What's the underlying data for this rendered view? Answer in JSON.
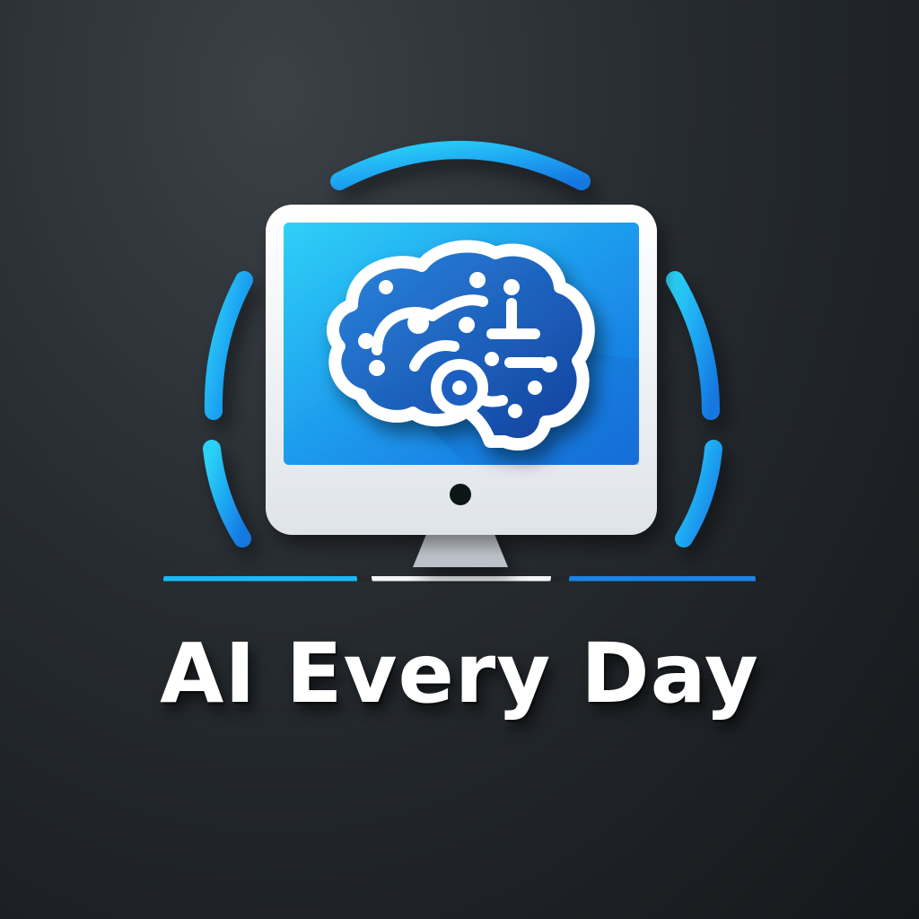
{
  "brand": {
    "name": "AI Every Day"
  },
  "icons": {
    "logo": "monitor-brain-icon",
    "monitor": "monitor-icon",
    "brain": "brain-circuit-icon",
    "ring": "segmented-ring-icon"
  },
  "colors": {
    "background": "#262b30",
    "accent_blue": "#1e9bf0",
    "accent_cyan": "#1fc0f5",
    "screen_blue": "#1a8fe8",
    "brain_blue": "#1c5fbd",
    "monitor_white": "#f4f6f8",
    "text": "#ffffff"
  }
}
